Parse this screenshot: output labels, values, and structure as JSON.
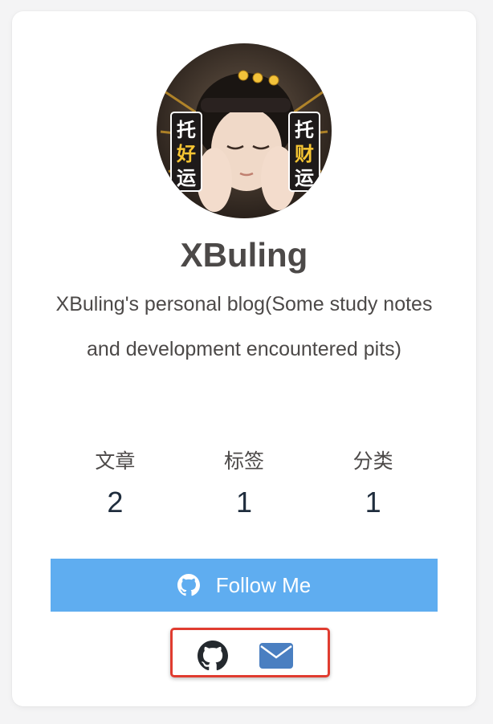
{
  "profile": {
    "name": "XBuling",
    "description": "XBuling's personal blog(Some study notes and development encountered pits)"
  },
  "avatar": {
    "left_sign": [
      "托",
      "好",
      "运"
    ],
    "right_sign": [
      "托",
      "财",
      "运"
    ]
  },
  "stats": [
    {
      "label": "文章",
      "value": "2"
    },
    {
      "label": "标签",
      "value": "1"
    },
    {
      "label": "分类",
      "value": "1"
    }
  ],
  "follow_button": {
    "label": "Follow Me",
    "icon": "github-icon",
    "color": "#5fadf0"
  },
  "social_links": [
    {
      "icon": "github-icon",
      "color": "#24292e"
    },
    {
      "icon": "envelope-icon",
      "color": "#4a7fc1"
    }
  ],
  "highlight_color": "#e03c30"
}
